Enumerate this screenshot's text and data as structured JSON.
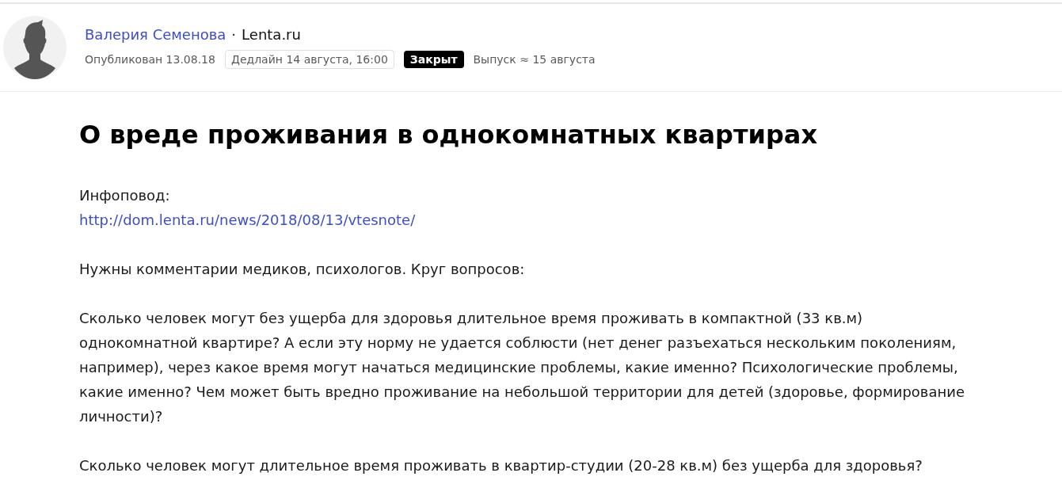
{
  "author": {
    "name": "Валерия Семенова",
    "separator": "·",
    "outlet": "Lenta.ru"
  },
  "meta": {
    "published": "Опубликован 13.08.18",
    "deadline": "Дедлайн 14 августа, 16:00",
    "status": {
      "label": "Закрыт",
      "kind": "closed"
    },
    "release": "Выпуск ≈ 15 августа"
  },
  "article": {
    "title": "О вреде проживания в однокомнатных квартирах",
    "paragraphs": [
      {
        "lines": [
          {
            "kind": "text",
            "text": "Инфоповод:"
          },
          {
            "kind": "link",
            "text": "http://dom.lenta.ru/news/2018/08/13/vtesnote/"
          }
        ]
      },
      {
        "lines": [
          {
            "kind": "text",
            "text": "Нужны комментарии медиков, психологов. Круг вопросов:"
          }
        ]
      },
      {
        "lines": [
          {
            "kind": "text",
            "text": "Сколько человек могут без ущерба для здоровья длительное время проживать в компактной (33 кв.м) однокомнатной квартире? А если эту норму не удается соблюсти (нет денег разъехаться нескольким поколениям, например), через какое время могут начаться медицинские проблемы, какие именно? Психологические проблемы, какие именно? Чем может быть вредно проживание на небольшой территории для детей (здоровье, формирование личности)?"
          }
        ]
      },
      {
        "lines": [
          {
            "kind": "text",
            "text": "Сколько человек могут длительное время проживать в квартир-студии (20-28 кв.м) без ущерба для здоровья?"
          }
        ]
      }
    ]
  }
}
